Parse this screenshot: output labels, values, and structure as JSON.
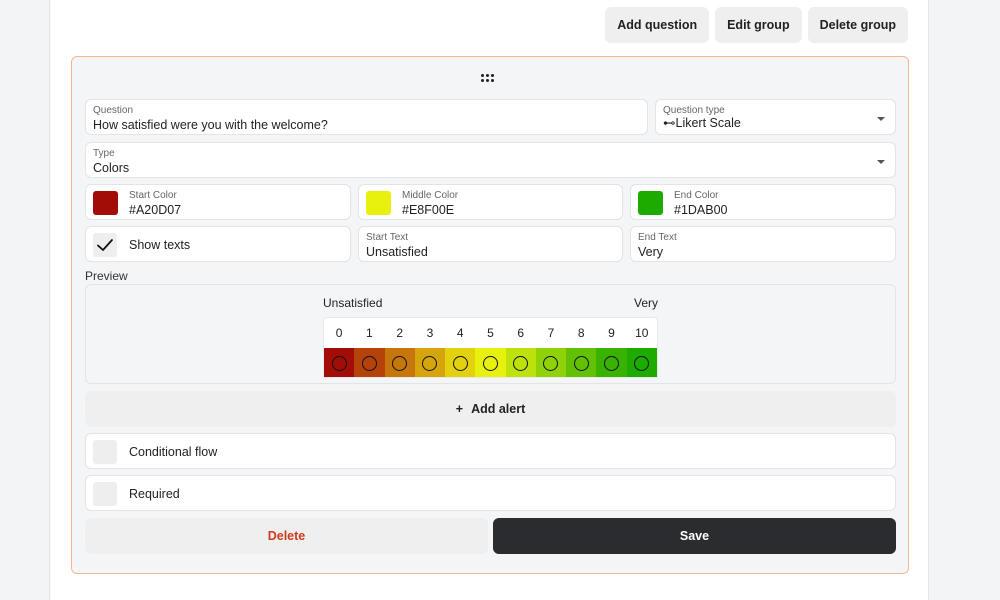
{
  "toolbar": {
    "add_question": "Add question",
    "edit_group": "Edit group",
    "delete_group": "Delete group"
  },
  "question": {
    "label": "Question",
    "value": "How satisfied were you with the welcome?"
  },
  "question_type": {
    "label": "Question type",
    "icon": "key-icon",
    "icon_glyph": "⊷",
    "value": "Likert Scale"
  },
  "type": {
    "label": "Type",
    "value": "Colors"
  },
  "colors": {
    "start": {
      "label": "Start Color",
      "value": "#A20D07"
    },
    "middle": {
      "label": "Middle Color",
      "value": "#E8F00E"
    },
    "end": {
      "label": "End Color",
      "value": "#1DAB00"
    }
  },
  "show_texts": {
    "label": "Show texts",
    "checked": true,
    "check_glyph": "✓"
  },
  "start_text": {
    "label": "Start Text",
    "value": "Unsatisfied"
  },
  "end_text": {
    "label": "End Text",
    "value": "Very"
  },
  "preview": {
    "label": "Preview",
    "start_text": "Unsatisfied",
    "end_text": "Very",
    "scale": [
      {
        "n": "0",
        "color": "#A20D07"
      },
      {
        "n": "1",
        "color": "#B5420A"
      },
      {
        "n": "2",
        "color": "#C7760C"
      },
      {
        "n": "3",
        "color": "#D6A50D"
      },
      {
        "n": "4",
        "color": "#E3D10E"
      },
      {
        "n": "5",
        "color": "#E8F00E"
      },
      {
        "n": "6",
        "color": "#BDE20B"
      },
      {
        "n": "7",
        "color": "#8FD208"
      },
      {
        "n": "8",
        "color": "#62C105"
      },
      {
        "n": "9",
        "color": "#39B202"
      },
      {
        "n": "10",
        "color": "#1DAB00"
      }
    ]
  },
  "add_alert": {
    "icon_glyph": "+",
    "label": "Add alert"
  },
  "conditional_flow": {
    "label": "Conditional flow",
    "checked": false
  },
  "required": {
    "label": "Required",
    "checked": false
  },
  "actions": {
    "delete": "Delete",
    "save": "Save"
  }
}
